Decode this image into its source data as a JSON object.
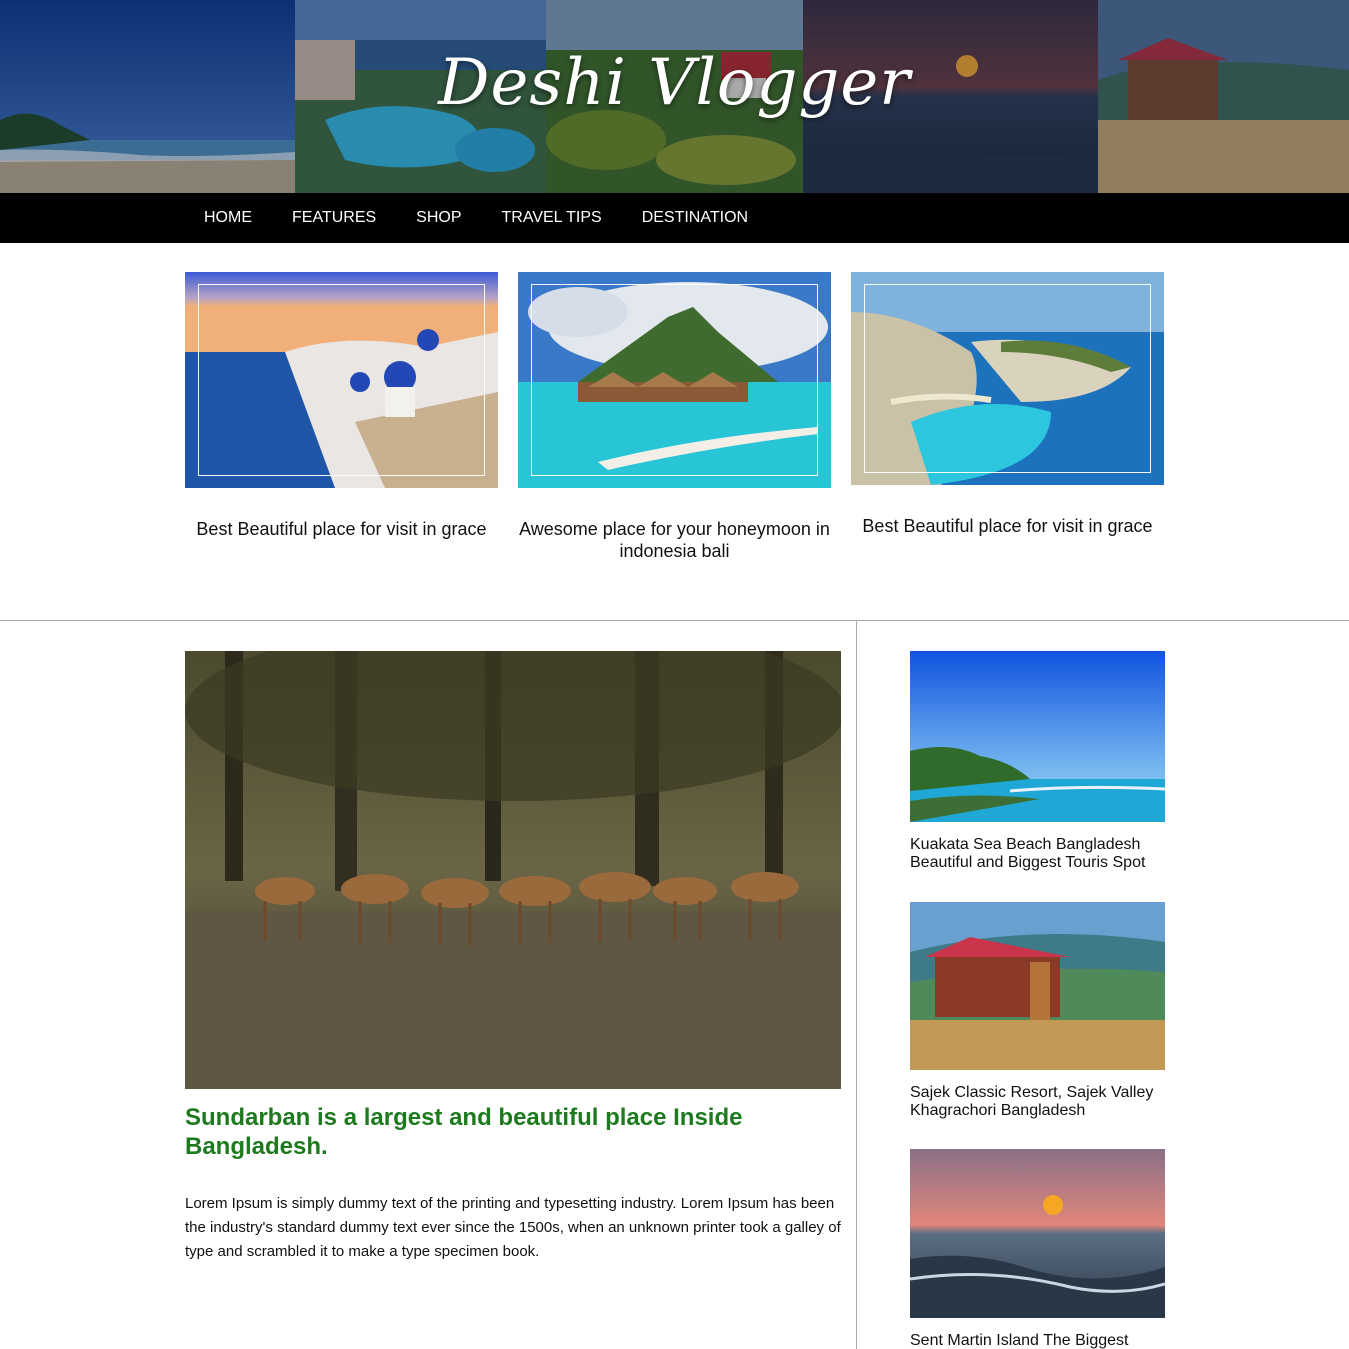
{
  "site": {
    "title": "Deshi Vlogger"
  },
  "nav": {
    "items": [
      "HOME",
      "FEATURES",
      "SHOP",
      "TRAVEL TIPS",
      "DESTINATION"
    ]
  },
  "featured": [
    {
      "caption": "Best Beautiful place for visit in grace",
      "image": "santorini-photo"
    },
    {
      "caption": "Awesome place for your honeymoon in indonesia bali",
      "image": "bali-resort-photo"
    },
    {
      "caption": "Best Beautiful place for visit in grace",
      "image": "navagio-beach-photo"
    }
  ],
  "article": {
    "title": "Sundarban is a largest and beautiful place Inside Bangladesh.",
    "body": "Lorem Ipsum is simply dummy text of the printing and typesetting industry. Lorem Ipsum has been the industry's standard dummy text ever since the 1500s, when an unknown printer took a galley of type and scrambled it to make a type specimen book.",
    "image": "sundarban-deer-photo",
    "title_color": "#1e7a1e"
  },
  "sidebar": {
    "items": [
      {
        "title": "Kuakata Sea Beach Bangladesh Beautiful and Biggest Touris Spot",
        "image": "kuakata-beach-photo"
      },
      {
        "title": "Sajek Classic Resort, Sajek Valley Khagrachori Bangladesh",
        "image": "sajek-resort-photo"
      },
      {
        "title": "Sent Martin Island The Biggest",
        "image": "sunset-sea-photo"
      }
    ]
  },
  "colors": {
    "nav_background": "#000000",
    "nav_text": "#ffffff",
    "divider": "#a9a9a9"
  }
}
